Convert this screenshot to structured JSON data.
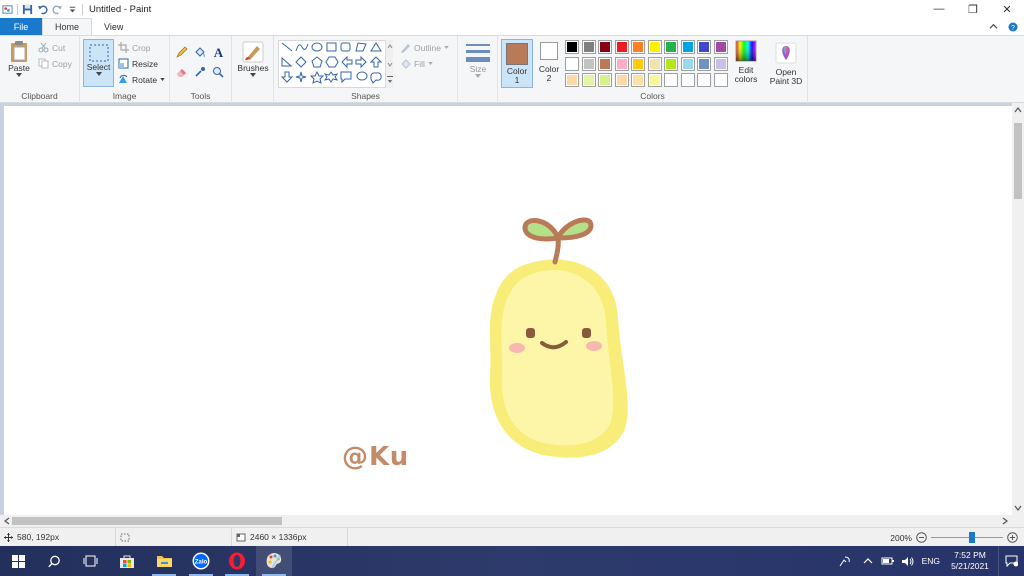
{
  "window": {
    "title": "Untitled - Paint",
    "controls": {
      "minimize": "—",
      "restore": "❐",
      "close": "✕"
    }
  },
  "tabs": [
    {
      "label": "File"
    },
    {
      "label": "Home"
    },
    {
      "label": "View"
    }
  ],
  "ribbon": {
    "clipboard": {
      "label": "Clipboard",
      "paste": "Paste",
      "cut": "Cut",
      "copy": "Copy"
    },
    "image": {
      "label": "Image",
      "select": "Select",
      "crop": "Crop",
      "resize": "Resize",
      "rotate": "Rotate"
    },
    "tools": {
      "label": "Tools"
    },
    "brushes": {
      "label": "Brushes"
    },
    "shapes": {
      "label": "Shapes",
      "outline": "Outline",
      "fill": "Fill"
    },
    "size": {
      "label": "Size"
    },
    "colors": {
      "label": "Colors",
      "color1_label": "Color",
      "color1_num": "1",
      "color2_label": "Color",
      "color2_num": "2",
      "color1_value": "#b97a57",
      "color2_value": "#ffffff",
      "edit_colors_1": "Edit",
      "edit_colors_2": "colors",
      "palette_row1": [
        "#000000",
        "#7f7f7f",
        "#880015",
        "#ed1c24",
        "#ff7f27",
        "#fff200",
        "#22b14c",
        "#00a2e8",
        "#3f48cc",
        "#a349a4"
      ],
      "palette_row2": [
        "#ffffff",
        "#c3c3c3",
        "#b97a57",
        "#ffaec9",
        "#ffc90e",
        "#efe4b0",
        "#b5e61d",
        "#99d9ea",
        "#7092be",
        "#c8bfe7"
      ],
      "palette_row3": [
        "#fdd9a8",
        "#e4f3a6",
        "#d7ef8d",
        "#fdd8a8",
        "#fde0a7",
        "#f8f79c",
        "#ffffff",
        "#ffffff",
        "#ffffff",
        "#ffffff"
      ]
    },
    "paint3d": {
      "line1": "Open",
      "line2": "Paint 3D"
    }
  },
  "canvas": {
    "signature": "@Ku",
    "colors": {
      "body_outer": "#f9ed7a",
      "body_inner": "#fdf6a8",
      "sprout": "#b97a57",
      "leaf": "#b5e08a",
      "blush": "#f7b8b0",
      "face": "#8a5a3c"
    }
  },
  "status": {
    "cursor_pos": "580, 192px",
    "image_size": "2460 × 1336px",
    "zoom": "200%",
    "zoom_percent": 57
  },
  "taskbar": {
    "language": "ENG",
    "time": "7:52 PM",
    "date": "5/21/2021",
    "zalo_label": "Zalo",
    "apps": [
      "windows-start",
      "search",
      "task-view",
      "microsoft-store",
      "file-explorer",
      "zalo",
      "opera",
      "paint"
    ]
  }
}
